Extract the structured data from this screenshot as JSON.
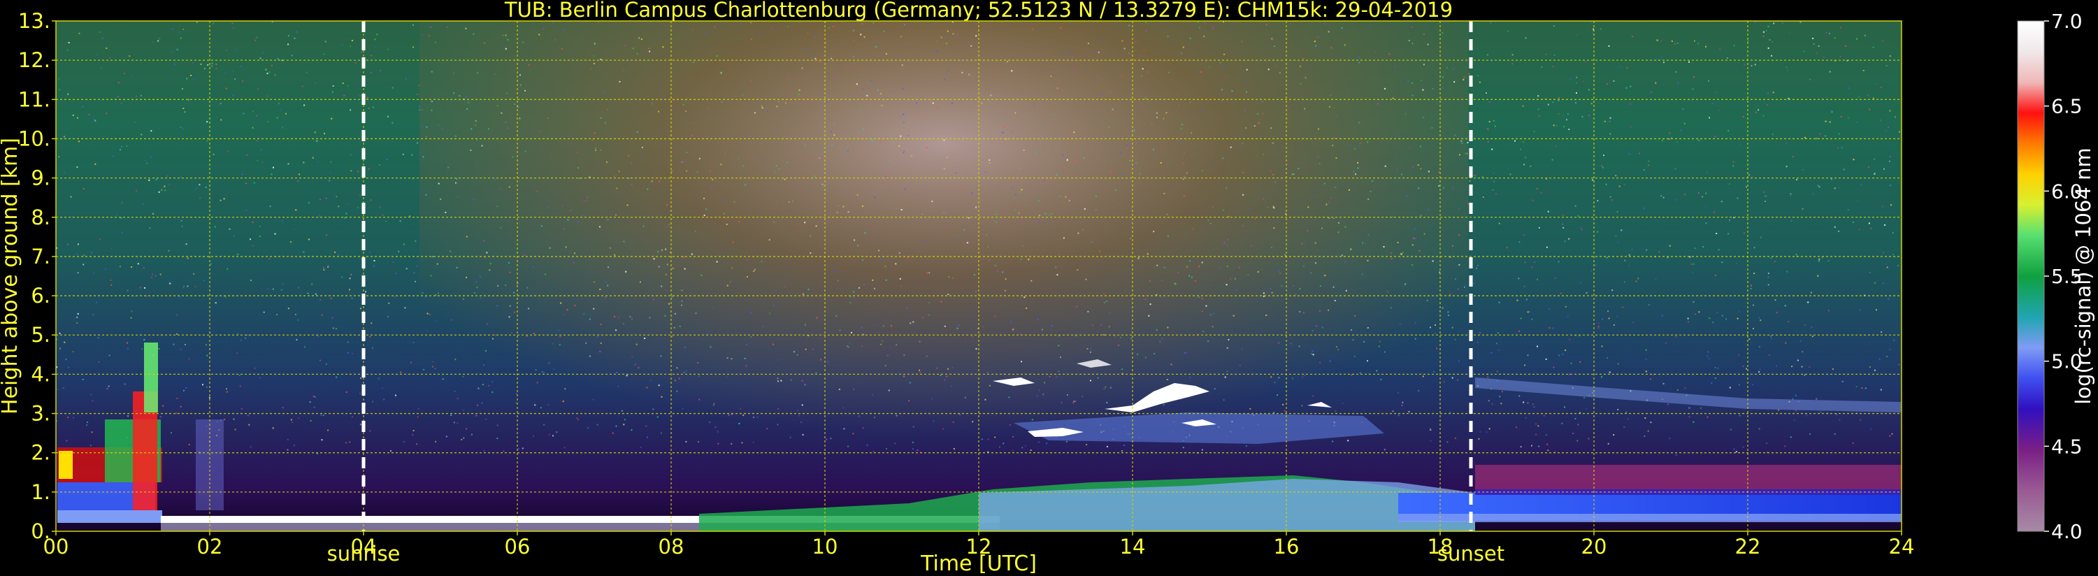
{
  "chart_data": {
    "type": "heatmap",
    "title": "TUB: Berlin Campus Charlottenburg (Germany; 52.5123 N / 13.3279 E):    CHM15k: 29-04-2019",
    "xlabel": "Time [UTC]",
    "ylabel": "Height above ground [km]",
    "xlim": [
      0,
      24
    ],
    "ylim": [
      0,
      13
    ],
    "x_ticks": [
      "00",
      "02",
      "04",
      "06",
      "08",
      "10",
      "12",
      "14",
      "16",
      "18",
      "20",
      "22",
      "24"
    ],
    "y_ticks": [
      "0.",
      "1.",
      "2.",
      "3.",
      "4.",
      "5.",
      "6.",
      "7.",
      "8.",
      "9.",
      "10.",
      "11.",
      "12.",
      "13."
    ],
    "grid": true,
    "events": [
      {
        "label": "sunrise",
        "time": 4.0
      },
      {
        "label": "sunset",
        "time": 18.4
      }
    ],
    "colorbar": {
      "label": "log(rc-signal) @ 1064 nm",
      "range": [
        4.0,
        7.0
      ],
      "ticks": [
        "4.0",
        "4.5",
        "5.0",
        "5.5",
        "6.0",
        "6.5",
        "7.0"
      ]
    },
    "colors": {
      "text_accent": "#ffff33",
      "grid": "#d4d400",
      "background": "#000000"
    }
  }
}
